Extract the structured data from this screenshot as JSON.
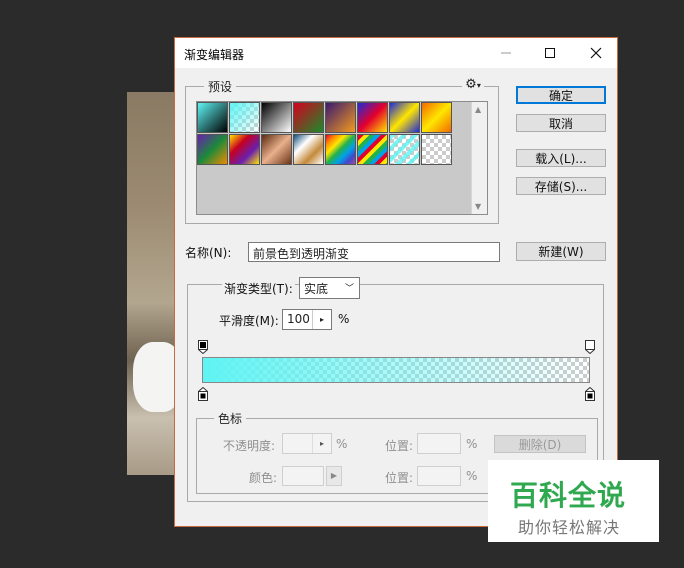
{
  "window": {
    "title": "渐变编辑器",
    "minimize_icon": "minimize-icon",
    "maximize_icon": "maximize-icon",
    "close_icon": "close-icon"
  },
  "presets": {
    "legend": "预设",
    "gear_icon": "gear-icon",
    "swatches_row1": [
      "cyan-black",
      "cyan-checker",
      "black-white",
      "red-green",
      "violet-orange",
      "blue-red-yellow",
      "blue-yellow-blue",
      "orange-yellow-orange"
    ],
    "swatches_row2": [
      "violet-green-orange",
      "rainbow-yellow-violet",
      "copper",
      "chrome",
      "spectrum",
      "rainbow-stripes",
      "transparent-stripes",
      "transparent-checker"
    ]
  },
  "buttons": {
    "ok": "确定",
    "cancel": "取消",
    "load": "载入(L)...",
    "save": "存储(S)...",
    "new": "新建(W)",
    "delete": "删除(D)"
  },
  "name": {
    "label": "名称(N):",
    "value": "前景色到透明渐变"
  },
  "gradient": {
    "type_label": "渐变类型(T):",
    "type_value": "实底",
    "smoothness_label": "平滑度(M):",
    "smoothness_value": "100",
    "smoothness_unit": "%",
    "color": "#5ff4f4"
  },
  "color_stops": {
    "legend": "色标",
    "opacity_label": "不透明度:",
    "opacity_unit": "%",
    "position_label": "位置:",
    "position_unit": "%",
    "color_label": "颜色:",
    "position2_label": "位置:",
    "position2_unit": "%"
  },
  "watermark": {
    "title": "百科全说",
    "subtitle": "助你轻松解决"
  }
}
